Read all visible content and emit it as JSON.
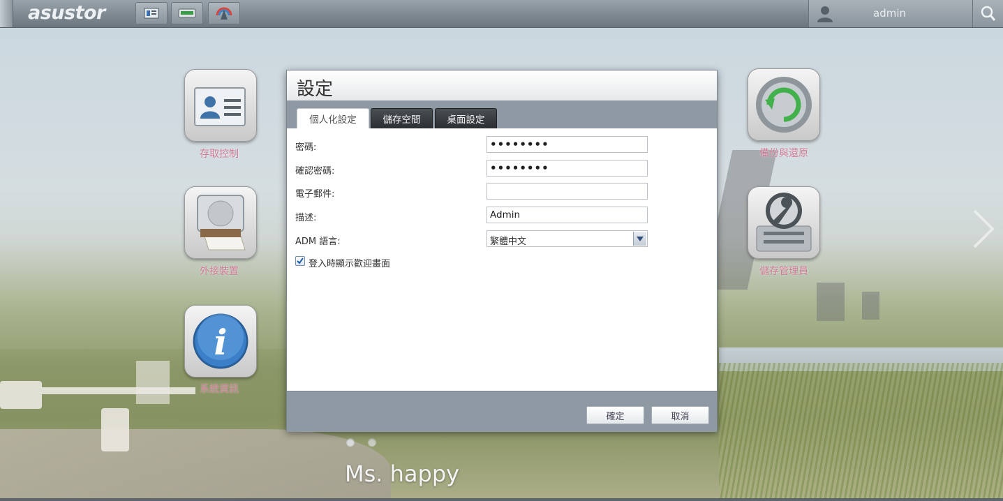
{
  "topbar": {
    "logo": "asustor",
    "app_buttons": [
      "app-list-icon",
      "storage-icon",
      "adm-icon"
    ],
    "user": "admin"
  },
  "desktop": {
    "icons": [
      {
        "name": "access-control",
        "label": "存取控制",
        "icon": "id-card-icon"
      },
      {
        "name": "external-devices",
        "label": "外接裝置",
        "icon": "external-drive-icon"
      },
      {
        "name": "system-info",
        "label": "系統資訊",
        "icon": "info-icon"
      },
      {
        "name": "backup-restore",
        "label": "備份與還原",
        "icon": "backup-icon"
      },
      {
        "name": "storage-manager",
        "label": "儲存管理員",
        "icon": "storage-wrench-icon"
      }
    ],
    "caption": "Ms. happy",
    "pages": 2,
    "current_page": 1
  },
  "dialog": {
    "title": "設定",
    "tabs": [
      {
        "label": "個人化設定",
        "active": true
      },
      {
        "label": "儲存空間",
        "active": false
      },
      {
        "label": "桌面設定",
        "active": false
      }
    ],
    "fields": {
      "password": {
        "label": "密碼:",
        "value": "••••••••"
      },
      "confirm_password": {
        "label": "確認密碼:",
        "value": "••••••••"
      },
      "email": {
        "label": "電子郵件:",
        "value": ""
      },
      "description": {
        "label": "描述:",
        "value": "Admin"
      },
      "language": {
        "label": "ADM 語言:",
        "value": "繁體中文"
      }
    },
    "welcome_checkbox": {
      "label": "登入時顯示歡迎畫面",
      "checked": true
    },
    "buttons": {
      "ok": "確定",
      "cancel": "取消"
    }
  },
  "colors": {
    "dialog_bar": "#8e99a4",
    "label_pink": "#d07a97",
    "tab_inactive": "#2b2f33"
  }
}
